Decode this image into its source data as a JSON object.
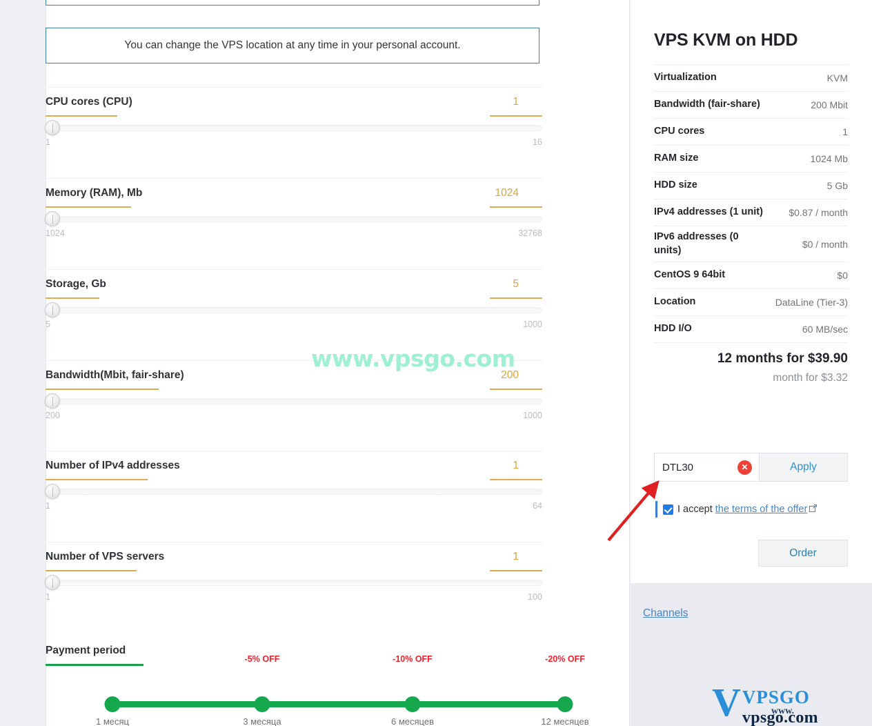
{
  "alerts": {
    "location_note": "You can change the VPS location at any time in your personal account."
  },
  "sliders": [
    {
      "label": "CPU cores (CPU)",
      "value": "1",
      "min": "1",
      "max": "16",
      "label_ul_w": 104,
      "value_w": 40
    },
    {
      "label": "Memory (RAM), Mb",
      "value": "1024",
      "min": "1024",
      "max": "32768",
      "label_ul_w": 124,
      "value_w": 40
    },
    {
      "label": "Storage, Gb",
      "value": "5",
      "min": "5",
      "max": "1000",
      "label_ul_w": 78,
      "value_w": 40
    },
    {
      "label": "Bandwidth(Mbit, fair-share)",
      "value": "200",
      "min": "200",
      "max": "1000",
      "label_ul_w": 164,
      "value_w": 40
    },
    {
      "label": "Number of IPv4 addresses",
      "value": "1",
      "min": "1",
      "max": "64",
      "label_ul_w": 148,
      "value_w": 40
    },
    {
      "label": "Number of VPS servers",
      "value": "1",
      "min": "1",
      "max": "100",
      "label_ul_w": 132,
      "value_w": 40
    }
  ],
  "payment_period": {
    "label": "Payment period",
    "selected_index": 3,
    "stops": [
      {
        "tick": "1 месяц",
        "discount": ""
      },
      {
        "tick": "3 месяца",
        "discount": "-5% OFF"
      },
      {
        "tick": "6 месяцев",
        "discount": "-10% OFF"
      },
      {
        "tick": "12 месяцев",
        "discount": "-20% OFF"
      }
    ]
  },
  "summary": {
    "title": "VPS KVM on HDD",
    "specs": [
      {
        "key": "Virtualization",
        "value": "KVM"
      },
      {
        "key": "Bandwidth (fair-share)",
        "value": "200 Mbit"
      },
      {
        "key": "CPU cores",
        "value": "1"
      },
      {
        "key": "RAM size",
        "value": "1024 Mb"
      },
      {
        "key": "HDD size",
        "value": "5 Gb"
      },
      {
        "key": "IPv4 addresses (1 unit)",
        "value": "$0.87 / month"
      },
      {
        "key": "IPv6 addresses (0 units)",
        "value": "$0 / month"
      },
      {
        "key": "CentOS 9 64bit",
        "value": "$0"
      },
      {
        "key": "Location",
        "value": "DataLine (Tier-3)"
      },
      {
        "key": "HDD I/O",
        "value": "60 MB/sec"
      }
    ],
    "price_main": "12 months for $39.90",
    "price_sub": "month for $3.32"
  },
  "coupon": {
    "value": "DTL30",
    "placeholder": "Promo code",
    "clear_label": "✕",
    "apply_label": "Apply"
  },
  "accept": {
    "text": "I accept",
    "link": "the terms of the offer",
    "external_icon": "↗"
  },
  "order_label": "Order",
  "channels_label": "Channels",
  "watermark": "www.vpsgo.com",
  "logo": {
    "mark": "V",
    "top": "VPSGO",
    "www": "www.",
    "bottom": "vpsgo.com"
  },
  "colors": {
    "accent_orange": "#e0aa4f",
    "value_orange": "#dba63f",
    "green": "#14a74b",
    "discount_red": "#f51d2a",
    "link_blue": "#4a84c4",
    "alert_border": "#3f7fa0",
    "watermark": "#9ef0d3",
    "arrow_red": "#e02020"
  }
}
